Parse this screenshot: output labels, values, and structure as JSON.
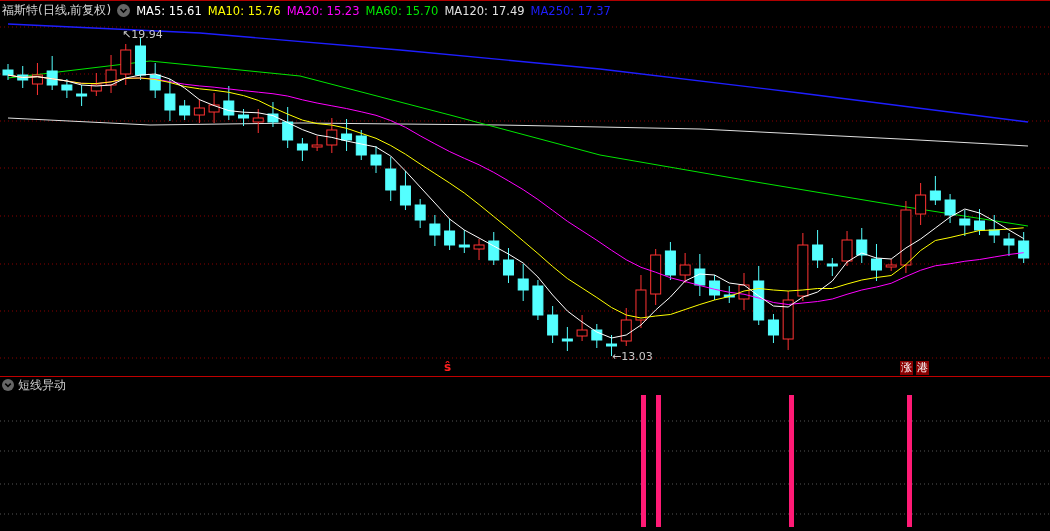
{
  "title": "福斯特(日线,前复权)",
  "ma_legend": [
    {
      "label": "MA5: 15.61",
      "color": "#ffffff"
    },
    {
      "label": "MA10: 15.76",
      "color": "#ffff00"
    },
    {
      "label": "MA20: 15.23",
      "color": "#ff00ff"
    },
    {
      "label": "MA60: 15.70",
      "color": "#00e600"
    },
    {
      "label": "MA120: 17.49",
      "color": "#e0e0e0"
    },
    {
      "label": "MA250: 17.37",
      "color": "#1e1eff"
    }
  ],
  "price_labels": [
    {
      "kind": "high",
      "text": "↖19.94"
    },
    {
      "kind": "low",
      "text": "←13.03"
    }
  ],
  "signals": [
    {
      "kind": "mark",
      "text": "ŝ"
    },
    {
      "kind": "badge",
      "text": "涨"
    },
    {
      "kind": "badge",
      "text": "港"
    }
  ],
  "indicator": {
    "title": "短线异动"
  }
}
